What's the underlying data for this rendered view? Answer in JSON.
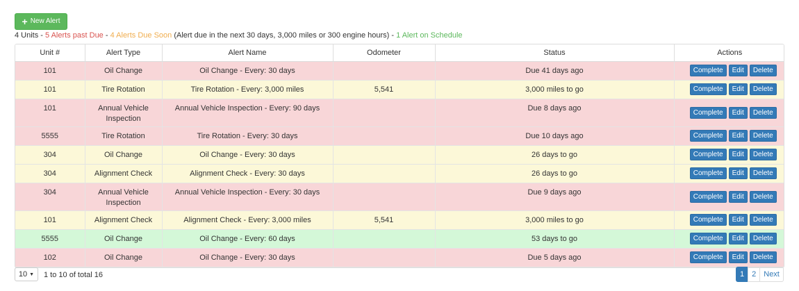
{
  "toolbar": {
    "new_alert_label": "New Alert"
  },
  "summary": {
    "units": "4 Units",
    "sep1": " - ",
    "past_due": "5 Alerts past Due",
    "sep2": " - ",
    "due_soon": "4 Alerts Due Soon",
    "due_note": " (Alert due in the next 30 days, 3,000 miles or 300 engine hours) - ",
    "on_schedule": "1 Alert on Schedule"
  },
  "colors": {
    "past": "#d9534f",
    "soon": "#f0ad4e",
    "ok": "#5cb85c",
    "primary": "#337ab7"
  },
  "table": {
    "headers": [
      "Unit #",
      "Alert Type",
      "Alert Name",
      "Odometer",
      "Status",
      "Actions"
    ],
    "action_labels": {
      "complete": "Complete",
      "edit": "Edit",
      "delete": "Delete"
    },
    "rows": [
      {
        "unit": "101",
        "type": "Oil Change",
        "name": "Oil Change - Every: 30 days",
        "odometer": "",
        "status": "Due 41 days ago",
        "state": "past"
      },
      {
        "unit": "101",
        "type": "Tire Rotation",
        "name": "Tire Rotation - Every: 3,000 miles",
        "odometer": "5,541",
        "status": "3,000 miles to go",
        "state": "soon"
      },
      {
        "unit": "101",
        "type": "Annual Vehicle Inspection",
        "name": "Annual Vehicle Inspection - Every: 90 days",
        "odometer": "",
        "status": "Due 8 days ago",
        "state": "past"
      },
      {
        "unit": "5555",
        "type": "Tire Rotation",
        "name": "Tire Rotation - Every: 30 days",
        "odometer": "",
        "status": "Due 10 days ago",
        "state": "past"
      },
      {
        "unit": "304",
        "type": "Oil Change",
        "name": "Oil Change - Every: 30 days",
        "odometer": "",
        "status": "26 days to go",
        "state": "soon"
      },
      {
        "unit": "304",
        "type": "Alignment Check",
        "name": "Alignment Check - Every: 30 days",
        "odometer": "",
        "status": "26 days to go",
        "state": "soon"
      },
      {
        "unit": "304",
        "type": "Annual Vehicle Inspection",
        "name": "Annual Vehicle Inspection - Every: 30 days",
        "odometer": "",
        "status": "Due 9 days ago",
        "state": "past"
      },
      {
        "unit": "101",
        "type": "Alignment Check",
        "name": "Alignment Check - Every: 3,000 miles",
        "odometer": "5,541",
        "status": "3,000 miles to go",
        "state": "soon"
      },
      {
        "unit": "5555",
        "type": "Oil Change",
        "name": "Oil Change - Every: 60 days",
        "odometer": "",
        "status": "53 days to go",
        "state": "ok"
      },
      {
        "unit": "102",
        "type": "Oil Change",
        "name": "Oil Change - Every: 30 days",
        "odometer": "",
        "status": "Due 5 days ago",
        "state": "past"
      }
    ]
  },
  "footer": {
    "page_size": "10",
    "info": "1 to 10 of total 16",
    "pages": [
      "1",
      "2"
    ],
    "next": "Next"
  }
}
